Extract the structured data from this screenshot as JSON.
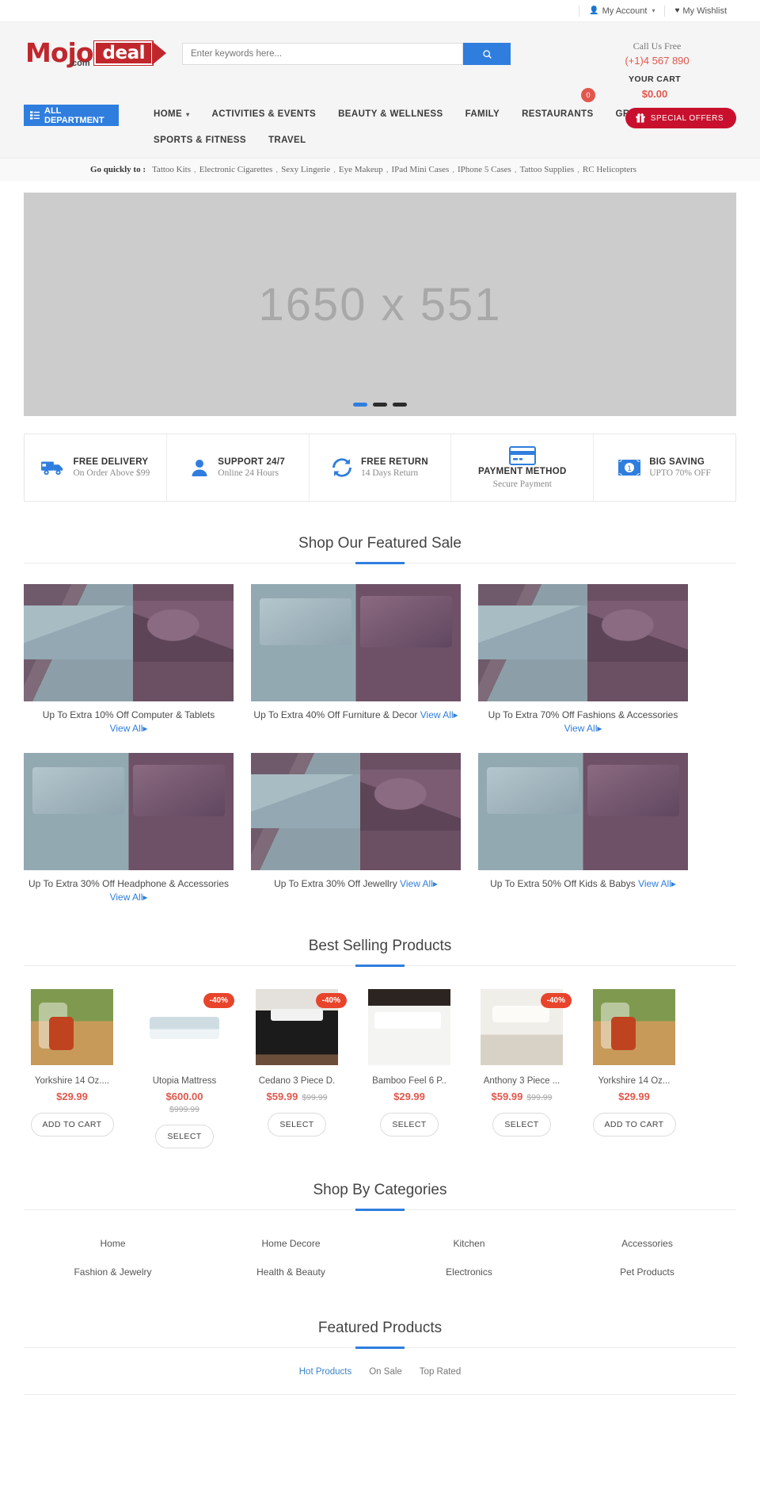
{
  "topbar": {
    "account": "My Account",
    "account_icon": "user-icon",
    "wishlist": "My Wishlist",
    "wishlist_icon": "heart-icon"
  },
  "header": {
    "logo": {
      "mojo": "Mojo",
      "deal": "deal",
      "com": ".com"
    },
    "search": {
      "placeholder": "Enter keywords here...",
      "value": "",
      "button_icon": "search-icon"
    },
    "call_label": "Call Us Free",
    "phone": "(+1)4 567 890",
    "cart_title": "YOUR CART",
    "cart_total": "$0.00",
    "cart_count": "0"
  },
  "nav": {
    "all_department": "ALL DEPARTMENT",
    "all_department_icon": "list-icon",
    "items": [
      {
        "label": "HOME",
        "has_caret": true
      },
      {
        "label": "ACTIVITIES & EVENTS",
        "has_caret": false
      },
      {
        "label": "BEAUTY & WELLNESS",
        "has_caret": false
      },
      {
        "label": "FAMILY",
        "has_caret": false
      },
      {
        "label": "RESTAURANTS",
        "has_caret": false
      },
      {
        "label": "GROCERY",
        "has_caret": false
      },
      {
        "label": "SPORTS & FITNESS",
        "has_caret": false
      },
      {
        "label": "TRAVEL",
        "has_caret": false
      }
    ],
    "special_offers": "SPECIAL OFFERS",
    "special_offers_icon": "gift-icon"
  },
  "quick_links": {
    "label": "Go quickly to :",
    "items": [
      "Tattoo Kits",
      "Electronic Cigarettes",
      "Sexy Lingerie",
      "Eye Makeup",
      "IPad Mini Cases",
      "IPhone 5 Cases",
      "Tattoo Supplies",
      "RC Helicopters"
    ]
  },
  "banner": {
    "placeholder_text": "1650 x 551",
    "dots": 3,
    "active_dot": 0
  },
  "services": [
    {
      "icon": "truck-icon",
      "title": "FREE DELIVERY",
      "subtitle": "On Order Above $99",
      "stacked": false
    },
    {
      "icon": "user-support-icon",
      "title": "SUPPORT 24/7",
      "subtitle": "Online 24 Hours",
      "stacked": false
    },
    {
      "icon": "refresh-icon",
      "title": "FREE RETURN",
      "subtitle": "14 Days Return",
      "stacked": false
    },
    {
      "icon": "credit-card-icon",
      "title": "PAYMENT METHOD",
      "subtitle": "Secure Payment",
      "stacked": true
    },
    {
      "icon": "money-icon",
      "title": "BIG SAVING",
      "subtitle": "UPTO 70% OFF",
      "stacked": false
    }
  ],
  "featured_sale": {
    "title": "Shop Our Featured Sale",
    "view_all": "View All",
    "cards": [
      {
        "caption": "Up To Extra 10% Off Computer & Tablets",
        "style": "bed-a"
      },
      {
        "caption": "Up To Extra 40% Off Furniture & Decor",
        "style": "bed-b"
      },
      {
        "caption": "Up To Extra 70% Off Fashions & Accessories",
        "style": "bed-a"
      },
      {
        "caption": "Up To Extra 30% Off Headphone & Accessories",
        "style": "bed-b"
      },
      {
        "caption": "Up To Extra 30% Off Jewellry",
        "style": "bed-a"
      },
      {
        "caption": "Up To Extra 50% Off Kids & Babys",
        "style": "bed-b"
      }
    ]
  },
  "best_selling": {
    "title": "Best Selling Products",
    "products": [
      {
        "name": "Yorkshire 14 Oz....",
        "price": "$29.99",
        "old_price": "",
        "badge": "",
        "button": "ADD TO CART",
        "style": "img-jars",
        "old_below": false
      },
      {
        "name": "Utopia Mattress",
        "price": "$600.00",
        "old_price": "$999.99",
        "badge": "-40%",
        "button": "SELECT",
        "style": "img-mattress",
        "old_below": true
      },
      {
        "name": "Cedano 3 Piece D.",
        "price": "$59.99",
        "old_price": "$99.99",
        "badge": "-40%",
        "button": "SELECT",
        "style": "img-black",
        "old_below": false
      },
      {
        "name": "Bamboo Feel 6 P..",
        "price": "$29.99",
        "old_price": "",
        "badge": "",
        "button": "SELECT",
        "style": "img-white",
        "old_below": false
      },
      {
        "name": "Anthony 3 Piece ...",
        "price": "$59.99",
        "old_price": "$99.99",
        "badge": "-40%",
        "button": "SELECT",
        "style": "img-anthony",
        "old_below": false
      },
      {
        "name": "Yorkshire 14 Oz...",
        "price": "$29.99",
        "old_price": "",
        "badge": "",
        "button": "ADD TO CART",
        "style": "img-jars",
        "old_below": false
      }
    ]
  },
  "categories": {
    "title": "Shop By Categories",
    "items": [
      "Home",
      "Home Decore",
      "Kitchen",
      "Accessories",
      "Fashion & Jewelry",
      "Health & Beauty",
      "Electronics",
      "Pet Products"
    ]
  },
  "featured_products": {
    "title": "Featured Products",
    "tabs": [
      {
        "label": "Hot Products",
        "active": true
      },
      {
        "label": "On Sale",
        "active": false
      },
      {
        "label": "Top Rated",
        "active": false
      }
    ]
  },
  "colors": {
    "accent_blue": "#2f7ede",
    "brand_red": "#c0272d",
    "price_red": "#e2574c",
    "badge_red": "#e8442c"
  }
}
